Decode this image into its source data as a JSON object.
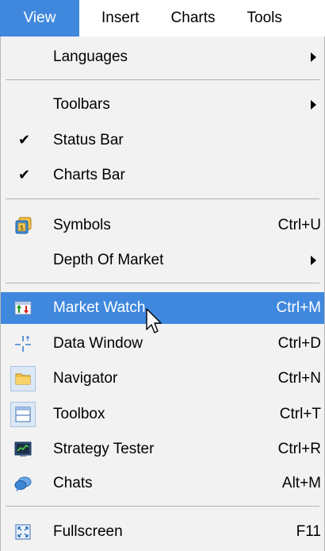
{
  "menubar": {
    "items": [
      {
        "label": "View"
      },
      {
        "label": "Insert"
      },
      {
        "label": "Charts"
      },
      {
        "label": "Tools"
      }
    ]
  },
  "menu": {
    "items": [
      {
        "label": "Languages",
        "has_submenu": true
      },
      {
        "label": "Toolbars",
        "has_submenu": true
      },
      {
        "label": "Status Bar",
        "checked": true
      },
      {
        "label": "Charts Bar",
        "checked": true
      },
      {
        "label": "Symbols",
        "shortcut": "Ctrl+U",
        "icon": "symbols-icon"
      },
      {
        "label": "Depth Of Market",
        "has_submenu": true
      },
      {
        "label": "Market Watch",
        "shortcut": "Ctrl+M",
        "icon": "market-watch-icon",
        "highlighted": true
      },
      {
        "label": "Data Window",
        "shortcut": "Ctrl+D",
        "icon": "crosshair-icon"
      },
      {
        "label": "Navigator",
        "shortcut": "Ctrl+N",
        "icon": "folder-icon",
        "toggled": true
      },
      {
        "label": "Toolbox",
        "shortcut": "Ctrl+T",
        "icon": "toolbox-icon",
        "toggled": true
      },
      {
        "label": "Strategy Tester",
        "shortcut": "Ctrl+R",
        "icon": "chart-monitor-icon"
      },
      {
        "label": "Chats",
        "shortcut": "Alt+M",
        "icon": "chat-bubbles-icon"
      },
      {
        "label": "Fullscreen",
        "shortcut": "F11",
        "icon": "fullscreen-icon"
      }
    ]
  },
  "colors": {
    "highlight": "#3f88dd",
    "menu_bg": "#f2f2f2"
  }
}
